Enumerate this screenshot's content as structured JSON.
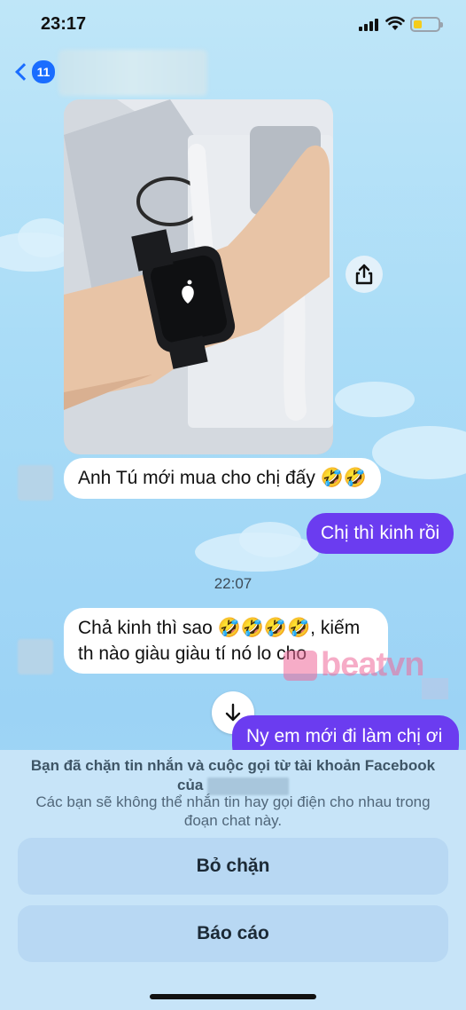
{
  "status_bar": {
    "time": "23:17"
  },
  "header": {
    "back_badge": "11"
  },
  "messages": {
    "incoming_1": "Anh Tú mới mua cho chị đấy 🤣🤣",
    "outgoing_1": "Chị thì kinh rồi",
    "timestamp": "22:07",
    "incoming_2_line1": "Chả kinh thì sao 🤣🤣🤣🤣, kiếm",
    "incoming_2_line2": "th nào giàu giàu tí nó lo cho",
    "outgoing_2": "Ny em mới đi làm chị ơi"
  },
  "watermark": {
    "text": "beatvn"
  },
  "block_sheet": {
    "notice_line1": "Bạn đã chặn tin nhắn và cuộc gọi từ tài khoản Facebook",
    "notice_prefix": "của",
    "subtext": "Các bạn sẽ không thể nhắn tin hay gọi điện cho nhau trong đoạn chat này.",
    "unblock_label": "Bỏ chặn",
    "report_label": "Báo cáo"
  },
  "colors": {
    "outgoing_bubble": "#6b3cf0",
    "accent_blue": "#1a6dff",
    "background": "#a9dcf7"
  },
  "icons": [
    "back-chevron-icon",
    "share-icon",
    "arrow-down-icon",
    "signal-icon",
    "wifi-icon",
    "battery-icon"
  ]
}
